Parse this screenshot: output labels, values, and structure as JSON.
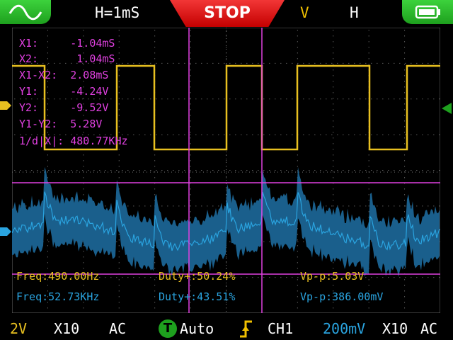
{
  "header": {
    "wave_icon": "sine-wave-icon",
    "timebase": "H=1mS",
    "run_state": "STOP",
    "v_label": "V",
    "h_label": "H",
    "battery_icon": "battery-icon"
  },
  "cursors": {
    "x1": "X1:     -1.04mS",
    "x2": "X2:      1.04mS",
    "dx": "X1-X2:  2.08mS",
    "y1": "Y1:     -4.24V",
    "y2": "Y2:     -9.52V",
    "dy": "Y1-Y2:  5.28V",
    "inv_dx": "1/d|X|: 480.77KHz"
  },
  "ch1": {
    "freq": "Freq:490.00Hz",
    "duty": "Duty+:50.24%",
    "vpp": "Vp-p:5.03V"
  },
  "ch2": {
    "freq": "Freq:52.73KHz",
    "duty": "Duty+:43.51%",
    "vpp": "Vp-p:386.00mV"
  },
  "footer": {
    "ch1_scale": "2V",
    "ch1_probe": "X10",
    "ch1_coupling": "AC",
    "trigger_icon": "T",
    "trigger_mode": "Auto",
    "trigger_source": "CH1",
    "ch2_scale": "200mV",
    "ch2_probe": "X10",
    "ch2_coupling": "AC"
  },
  "colors": {
    "ch1": "#e8c020",
    "ch2": "#2aa4e0",
    "cursor": "#e040e0",
    "trigger": "#1ea01e"
  }
}
